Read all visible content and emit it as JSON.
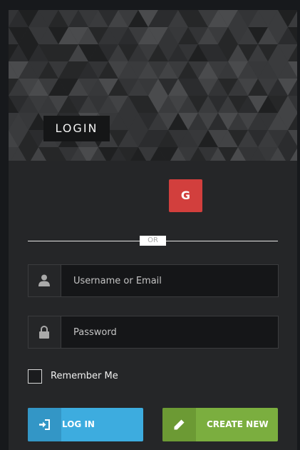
{
  "banner": {
    "title": "LOGIN"
  },
  "social": {
    "google_label": "G"
  },
  "divider": {
    "label": "OR"
  },
  "form": {
    "username_placeholder": "Username or Email",
    "password_placeholder": "Password",
    "remember_label": "Remember Me",
    "remember_checked": false
  },
  "actions": {
    "login_label": "LOG IN",
    "create_label": "CREATE NEW"
  },
  "icons": {
    "user": "user-icon",
    "lock": "lock-icon",
    "login": "sign-in-icon",
    "create": "pencil-icon"
  },
  "colors": {
    "google": "#d23f3d",
    "login": "#3dacdf",
    "create": "#7bae3f",
    "background": "#252628"
  }
}
